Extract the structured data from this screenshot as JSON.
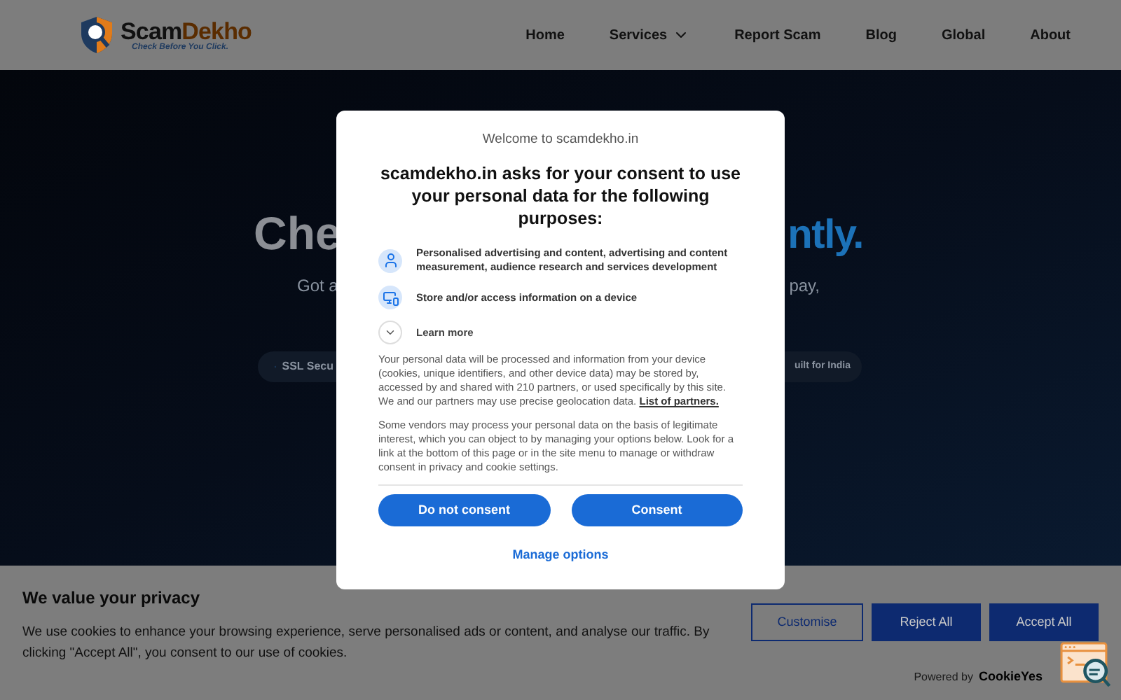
{
  "header": {
    "logo": {
      "name_start": "Scam",
      "name_end": "Dekho",
      "tagline": "Check Before You Click."
    },
    "nav": [
      {
        "label": "Home",
        "dropdown": false
      },
      {
        "label": "Services",
        "dropdown": true
      },
      {
        "label": "Report Scam",
        "dropdown": false
      },
      {
        "label": "Blog",
        "dropdown": false
      },
      {
        "label": "Global",
        "dropdown": false
      },
      {
        "label": "About",
        "dropdown": false
      }
    ]
  },
  "hero": {
    "heading_left": "Che",
    "heading_right": "ntly.",
    "subtitle_left": "Got a",
    "subtitle_right": "pay,",
    "badge_left": "SSL Secu",
    "badge_right": "uilt for India"
  },
  "consent_dialog": {
    "welcome": "Welcome to scamdekho.in",
    "title": "scamdekho.in asks for your consent to use your personal data for the following purposes:",
    "purposes": [
      {
        "kind": "person",
        "text": "Personalised advertising and content, advertising and content measurement, audience research and services development"
      },
      {
        "kind": "device",
        "text": "Store and/or access information on a device"
      }
    ],
    "learn_more": {
      "label": "Learn more",
      "expanded": false
    },
    "paragraph_1": "Your personal data will be processed and information from your device (cookies, unique identifiers, and other device data) may be stored by, accessed by and shared with 210 partners, or used specifically by this site. We and our partners may use precise geolocation data.",
    "partners_link": "List of partners.",
    "paragraph_2": "Some vendors may process your personal data on the basis of legitimate interest, which you can object to by managing your options below. Look for a link at the bottom of this page or in the site menu to manage or withdraw consent in privacy and cookie settings.",
    "buttons": [
      "Do not consent",
      "Consent"
    ],
    "manage_link": "Manage options"
  },
  "cookie_banner": {
    "title": "We value your privacy",
    "text": "We use cookies to enhance your browsing experience, serve personalised ads or content, and analyse our traffic. By clicking \"Accept All\", you consent to our use of cookies.",
    "buttons": [
      {
        "label": "Customise",
        "kind": "outline"
      },
      {
        "label": "Reject All",
        "kind": "solid"
      },
      {
        "label": "Accept All",
        "kind": "solid"
      }
    ],
    "powered_by": "Powered by",
    "brand": "CookieYes"
  }
}
